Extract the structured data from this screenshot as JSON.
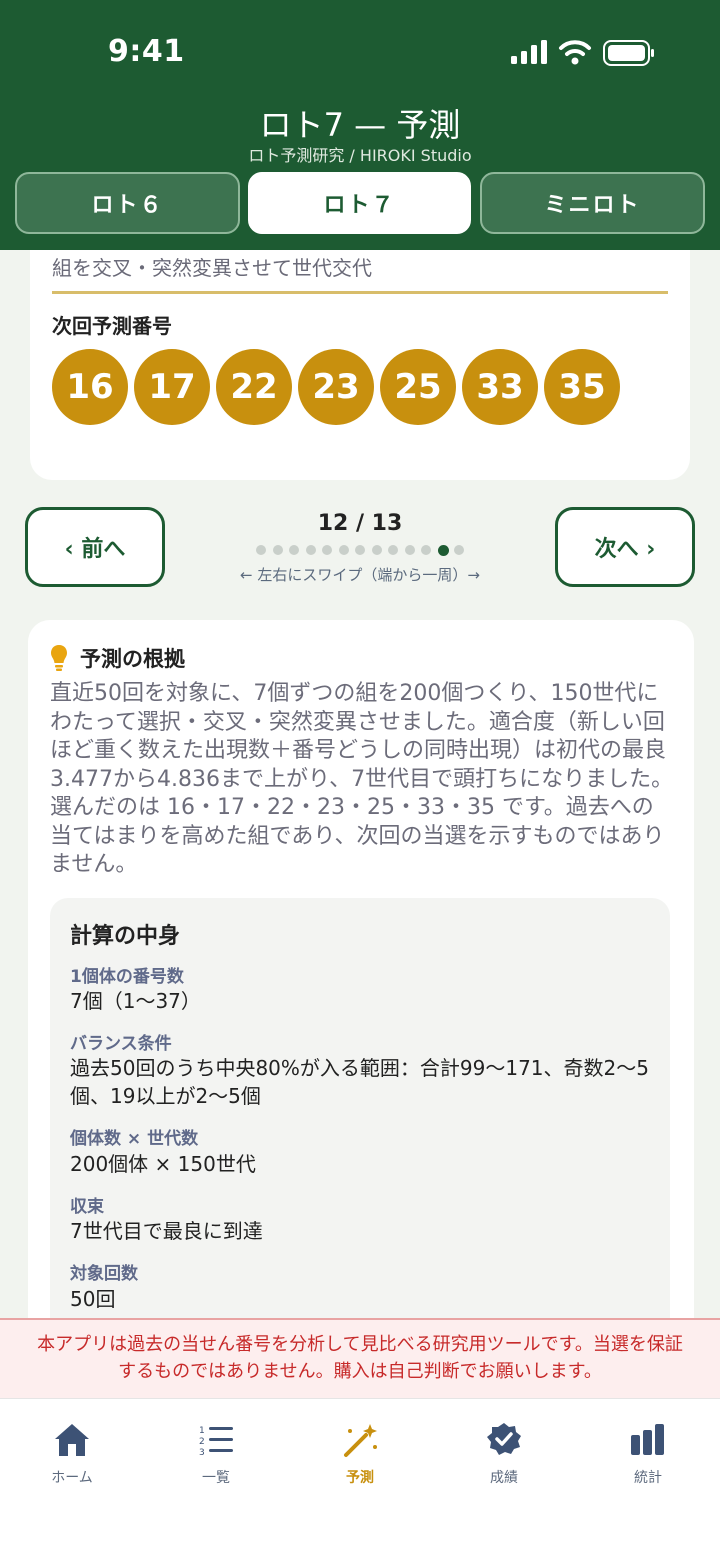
{
  "status": {
    "time": "9:41"
  },
  "header": {
    "title": "ロト7 — 予測",
    "subtitle": "ロト予測研究 / HIROKI Studio",
    "tabs": [
      {
        "label": "ロト６",
        "active": false
      },
      {
        "label": "ロト７",
        "active": true
      },
      {
        "label": "ミニロト",
        "active": false
      }
    ]
  },
  "method_card": {
    "description_tail": "組を交叉・突然変異させて世代交代",
    "next_heading": "次回予測番号",
    "numbers": [
      "16",
      "17",
      "22",
      "23",
      "25",
      "33",
      "35"
    ]
  },
  "pager": {
    "prev_label": "‹ 前へ",
    "next_label": "次へ ›",
    "counter": "12 / 13",
    "current": 12,
    "total": 13,
    "hint": "← 左右にスワイプ（端から一周）→"
  },
  "reason": {
    "heading": "予測の根拠",
    "body": "直近50回を対象に、7個ずつの組を200個つくり、150世代にわたって選択・交叉・突然変異させました。適合度（新しい回ほど重く数えた出現数＋番号どうしの同時出現）は初代の最良3.477から4.836まで上がり、7世代目で頭打ちになりました。選んだのは 16・17・22・23・25・33・35 です。過去への当てはまりを高めた組であり、次回の当選を示すものではありません。",
    "calc": {
      "heading": "計算の中身",
      "items": [
        {
          "label": "1個体の番号数",
          "value": "7個（1〜37）"
        },
        {
          "label": "バランス条件",
          "value": "過去50回のうち中央80%が入る範囲：合計99〜171、奇数2〜5個、19以上が2〜5個"
        },
        {
          "label": "個体数 × 世代数",
          "value": "200個体 × 150世代"
        },
        {
          "label": "収束",
          "value": "7世代目で最良に到達"
        },
        {
          "label": "対象回数",
          "value": "50回"
        }
      ]
    }
  },
  "disclaimer": "本アプリは過去の当せん番号を分析して見比べる研究用ツールです。当選を保証するものではありません。購入は自己判断でお願いします。",
  "bottom_nav": [
    {
      "label": "ホーム",
      "icon": "home-icon",
      "active": false
    },
    {
      "label": "一覧",
      "icon": "list-icon",
      "active": false
    },
    {
      "label": "予測",
      "icon": "magic-wand-icon",
      "active": true
    },
    {
      "label": "成績",
      "icon": "verified-badge-icon",
      "active": false
    },
    {
      "label": "統計",
      "icon": "bar-chart-icon",
      "active": false
    }
  ],
  "colors": {
    "brand_green": "#1d5b32",
    "ball_gold": "#c8900e",
    "warning_red": "#c72a2a"
  }
}
